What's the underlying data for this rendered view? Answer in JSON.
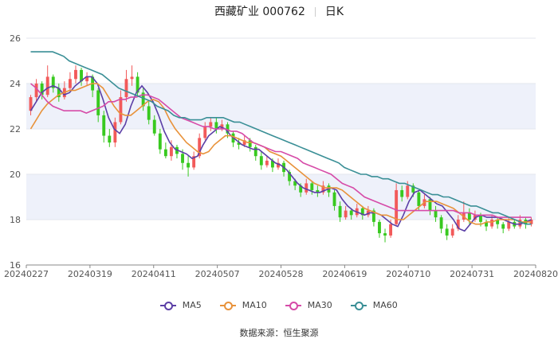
{
  "title": {
    "name": "西藏矿业 000762",
    "period": "日K"
  },
  "source": {
    "label": "数据来源：",
    "value": "恒生聚源"
  },
  "legend": [
    {
      "name": "MA5",
      "color": "#5b3fa6"
    },
    {
      "name": "MA10",
      "color": "#e8923a"
    },
    {
      "name": "MA30",
      "color": "#d64ba8"
    },
    {
      "name": "MA60",
      "color": "#3a8f96"
    }
  ],
  "colors": {
    "up": "#f25a5a",
    "down": "#38c91f",
    "band": "#eef1fa"
  },
  "chart_data": {
    "type": "candlestick",
    "ylim": [
      16,
      26
    ],
    "yticks": [
      16,
      18,
      20,
      22,
      24,
      26
    ],
    "xticks": [
      "20240227",
      "20240319",
      "20240411",
      "20240507",
      "20240528",
      "20240619",
      "20240710",
      "20240731",
      "20240820"
    ],
    "grid": true,
    "legend_position": "bottom",
    "series": [
      {
        "name": "MA5",
        "values": [
          22.8,
          23.2,
          23.6,
          23.8,
          23.9,
          23.8,
          23.5,
          23.6,
          23.9,
          24.1,
          24.3,
          24.3,
          24.0,
          23.3,
          22.5,
          22.0,
          21.8,
          22.2,
          23.0,
          23.6,
          23.9,
          23.6,
          23.2,
          22.6,
          21.9,
          21.4,
          21.1,
          21.0,
          20.9,
          20.7,
          20.8,
          21.3,
          21.7,
          21.9,
          22.1,
          22.0,
          21.7,
          21.5,
          21.3,
          21.2,
          21.1,
          21.1,
          20.9,
          20.7,
          20.5,
          20.4,
          20.2,
          19.9,
          19.6,
          19.4,
          19.3,
          19.2,
          19.2,
          19.3,
          19.4,
          19.3,
          18.9,
          18.6,
          18.4,
          18.3,
          18.2,
          18.3,
          18.3,
          18.2,
          18.0,
          17.8,
          17.7,
          18.2,
          18.8,
          19.2,
          19.3,
          19.1,
          18.9,
          18.7,
          18.6,
          18.3,
          18.0,
          17.6,
          17.5,
          17.8,
          18.1,
          18.2,
          18.1,
          18.1,
          18.1,
          18.0,
          17.9,
          17.8,
          17.8,
          17.9,
          18.0
        ]
      },
      {
        "name": "MA10",
        "values": [
          22.0,
          22.4,
          22.8,
          23.1,
          23.3,
          23.5,
          23.6,
          23.7,
          23.7,
          23.8,
          23.9,
          24.0,
          24.0,
          23.8,
          23.4,
          23.0,
          22.7,
          22.6,
          22.6,
          22.8,
          23.0,
          23.2,
          23.3,
          23.2,
          22.9,
          22.4,
          22.0,
          21.7,
          21.4,
          21.2,
          21.0,
          20.9,
          21.0,
          21.3,
          21.5,
          21.7,
          21.7,
          21.6,
          21.5,
          21.4,
          21.4,
          21.3,
          21.2,
          21.0,
          20.9,
          20.8,
          20.6,
          20.4,
          20.2,
          20.0,
          19.8,
          19.6,
          19.5,
          19.4,
          19.4,
          19.4,
          19.3,
          19.1,
          18.9,
          18.7,
          18.5,
          18.4,
          18.3,
          18.2,
          18.2,
          18.1,
          18.0,
          18.0,
          18.2,
          18.4,
          18.6,
          18.8,
          18.8,
          18.8,
          18.7,
          18.6,
          18.5,
          18.3,
          18.1,
          17.9,
          17.8,
          17.8,
          17.9,
          17.9,
          18.0,
          18.0,
          18.0,
          18.0,
          17.9,
          17.9,
          17.9
        ]
      },
      {
        "name": "MA30",
        "values": [
          24.0,
          23.8,
          23.5,
          23.2,
          23.0,
          22.9,
          22.8,
          22.8,
          22.8,
          22.8,
          22.7,
          22.8,
          22.9,
          23.0,
          23.2,
          23.2,
          23.3,
          23.3,
          23.4,
          23.4,
          23.5,
          23.5,
          23.4,
          23.3,
          23.1,
          22.9,
          22.7,
          22.5,
          22.4,
          22.3,
          22.2,
          22.1,
          22.1,
          22.0,
          22.0,
          22.0,
          21.9,
          21.9,
          21.8,
          21.6,
          21.4,
          21.3,
          21.2,
          21.1,
          21.0,
          21.0,
          20.9,
          20.8,
          20.7,
          20.5,
          20.4,
          20.3,
          20.2,
          20.1,
          20.0,
          19.8,
          19.6,
          19.5,
          19.4,
          19.2,
          19.0,
          18.9,
          18.8,
          18.7,
          18.6,
          18.5,
          18.4,
          18.4,
          18.4,
          18.4,
          18.4,
          18.4,
          18.4,
          18.4,
          18.4,
          18.4,
          18.4,
          18.3,
          18.3,
          18.3,
          18.2,
          18.2,
          18.2,
          18.2,
          18.1,
          18.1,
          18.1,
          18.1,
          18.1,
          18.1,
          18.1
        ]
      },
      {
        "name": "MA60",
        "values": [
          25.4,
          25.4,
          25.4,
          25.4,
          25.4,
          25.3,
          25.2,
          25.0,
          24.9,
          24.8,
          24.7,
          24.6,
          24.5,
          24.4,
          24.2,
          24.0,
          23.8,
          23.7,
          23.6,
          23.5,
          23.4,
          23.3,
          23.2,
          23.0,
          22.9,
          22.8,
          22.6,
          22.5,
          22.5,
          22.4,
          22.4,
          22.4,
          22.5,
          22.5,
          22.5,
          22.5,
          22.4,
          22.3,
          22.3,
          22.2,
          22.1,
          22.0,
          21.9,
          21.8,
          21.7,
          21.6,
          21.5,
          21.4,
          21.3,
          21.2,
          21.1,
          21.0,
          20.9,
          20.8,
          20.7,
          20.6,
          20.5,
          20.3,
          20.2,
          20.1,
          20.0,
          20.0,
          19.9,
          19.9,
          19.8,
          19.8,
          19.7,
          19.6,
          19.6,
          19.5,
          19.4,
          19.3,
          19.2,
          19.1,
          19.1,
          19.0,
          19.0,
          18.9,
          18.8,
          18.7,
          18.6,
          18.6,
          18.5,
          18.4,
          18.3,
          18.3,
          18.2,
          18.1,
          18.0,
          17.9,
          17.8,
          17.8
        ]
      },
      {
        "name": "candles",
        "ohlc": [
          [
            22.8,
            23.4,
            22.6,
            23.5
          ],
          [
            23.4,
            24.0,
            23.2,
            24.2
          ],
          [
            24.0,
            23.5,
            23.3,
            24.1
          ],
          [
            23.5,
            24.3,
            23.4,
            24.8
          ],
          [
            24.3,
            23.8,
            23.6,
            24.4
          ],
          [
            23.8,
            23.4,
            23.2,
            24.0
          ],
          [
            23.4,
            23.8,
            23.3,
            24.1
          ],
          [
            23.8,
            24.2,
            23.7,
            24.5
          ],
          [
            24.2,
            24.6,
            24.0,
            24.8
          ],
          [
            24.6,
            24.1,
            23.9,
            24.7
          ],
          [
            24.1,
            24.3,
            23.9,
            24.5
          ],
          [
            24.3,
            23.7,
            23.4,
            24.4
          ],
          [
            23.7,
            22.6,
            22.3,
            23.8
          ],
          [
            22.6,
            21.7,
            21.4,
            22.8
          ],
          [
            21.7,
            21.4,
            21.2,
            22.0
          ],
          [
            21.4,
            22.3,
            21.2,
            22.5
          ],
          [
            22.3,
            23.4,
            22.2,
            23.7
          ],
          [
            23.4,
            24.2,
            23.2,
            24.6
          ],
          [
            24.2,
            24.3,
            23.9,
            24.8
          ],
          [
            24.3,
            23.6,
            23.4,
            24.5
          ],
          [
            23.6,
            23.0,
            22.8,
            23.8
          ],
          [
            23.0,
            22.4,
            22.2,
            23.2
          ],
          [
            22.4,
            21.8,
            21.7,
            22.6
          ],
          [
            21.8,
            21.1,
            20.9,
            22.0
          ],
          [
            21.1,
            20.8,
            20.7,
            21.4
          ],
          [
            20.8,
            21.2,
            20.6,
            21.5
          ],
          [
            21.2,
            20.9,
            20.7,
            21.3
          ],
          [
            20.9,
            20.5,
            20.2,
            21.1
          ],
          [
            20.5,
            20.3,
            19.9,
            20.8
          ],
          [
            20.3,
            20.8,
            20.2,
            21.0
          ],
          [
            20.8,
            21.6,
            20.7,
            21.8
          ],
          [
            21.6,
            22.1,
            21.5,
            22.3
          ],
          [
            22.1,
            22.3,
            21.9,
            22.5
          ],
          [
            22.3,
            22.0,
            21.8,
            22.5
          ],
          [
            22.0,
            22.2,
            21.9,
            22.4
          ],
          [
            22.2,
            21.8,
            21.6,
            22.3
          ],
          [
            21.8,
            21.4,
            21.2,
            21.9
          ],
          [
            21.4,
            21.3,
            21.1,
            21.6
          ],
          [
            21.3,
            21.5,
            21.2,
            21.7
          ],
          [
            21.5,
            21.2,
            21.0,
            21.6
          ],
          [
            21.2,
            20.8,
            20.6,
            21.3
          ],
          [
            20.8,
            20.4,
            20.2,
            21.0
          ],
          [
            20.4,
            20.6,
            20.3,
            20.8
          ],
          [
            20.6,
            20.3,
            20.1,
            20.7
          ],
          [
            20.3,
            20.5,
            20.2,
            20.7
          ],
          [
            20.5,
            20.1,
            19.9,
            20.6
          ],
          [
            20.1,
            19.7,
            19.5,
            20.2
          ],
          [
            19.7,
            19.5,
            19.3,
            19.8
          ],
          [
            19.5,
            19.2,
            19.0,
            19.6
          ],
          [
            19.2,
            19.6,
            19.1,
            19.8
          ],
          [
            19.6,
            19.3,
            19.1,
            19.7
          ],
          [
            19.3,
            19.2,
            19.0,
            19.5
          ],
          [
            19.2,
            19.5,
            19.1,
            19.7
          ],
          [
            19.5,
            19.2,
            19.0,
            19.6
          ],
          [
            19.2,
            18.6,
            18.4,
            19.3
          ],
          [
            18.6,
            18.1,
            17.9,
            18.8
          ],
          [
            18.1,
            18.4,
            18.0,
            18.6
          ],
          [
            18.4,
            18.2,
            18.0,
            18.5
          ],
          [
            18.2,
            18.5,
            18.1,
            18.7
          ],
          [
            18.5,
            18.2,
            18.0,
            18.6
          ],
          [
            18.2,
            18.4,
            18.1,
            18.6
          ],
          [
            18.4,
            17.9,
            17.7,
            18.5
          ],
          [
            17.9,
            17.4,
            17.2,
            18.0
          ],
          [
            17.4,
            17.3,
            17.0,
            17.6
          ],
          [
            17.3,
            17.8,
            17.2,
            18.0
          ],
          [
            17.8,
            19.3,
            17.7,
            19.6
          ],
          [
            19.3,
            19.0,
            18.8,
            19.5
          ],
          [
            19.0,
            19.5,
            18.9,
            19.7
          ],
          [
            19.5,
            19.2,
            19.0,
            19.6
          ],
          [
            19.2,
            18.6,
            18.4,
            19.3
          ],
          [
            18.6,
            18.9,
            18.5,
            19.1
          ],
          [
            18.9,
            18.4,
            18.2,
            19.0
          ],
          [
            18.4,
            18.1,
            17.9,
            18.6
          ],
          [
            18.1,
            17.6,
            17.4,
            18.2
          ],
          [
            17.6,
            17.3,
            17.1,
            17.8
          ],
          [
            17.3,
            17.6,
            17.2,
            17.8
          ],
          [
            17.6,
            18.0,
            17.5,
            18.2
          ],
          [
            18.0,
            18.3,
            17.9,
            18.8
          ],
          [
            18.3,
            18.0,
            17.8,
            18.5
          ],
          [
            18.0,
            18.2,
            17.9,
            18.4
          ],
          [
            18.2,
            17.9,
            17.7,
            18.3
          ],
          [
            17.9,
            17.7,
            17.5,
            18.0
          ],
          [
            17.7,
            18.0,
            17.6,
            18.2
          ],
          [
            18.0,
            17.8,
            17.6,
            18.1
          ],
          [
            17.8,
            17.6,
            17.4,
            17.9
          ],
          [
            17.6,
            17.9,
            17.5,
            18.1
          ],
          [
            17.9,
            17.7,
            17.6,
            18.0
          ],
          [
            17.7,
            18.0,
            17.6,
            18.2
          ],
          [
            18.0,
            17.8,
            17.6,
            18.1
          ],
          [
            17.8,
            18.0,
            17.7,
            18.1
          ]
        ]
      }
    ]
  }
}
